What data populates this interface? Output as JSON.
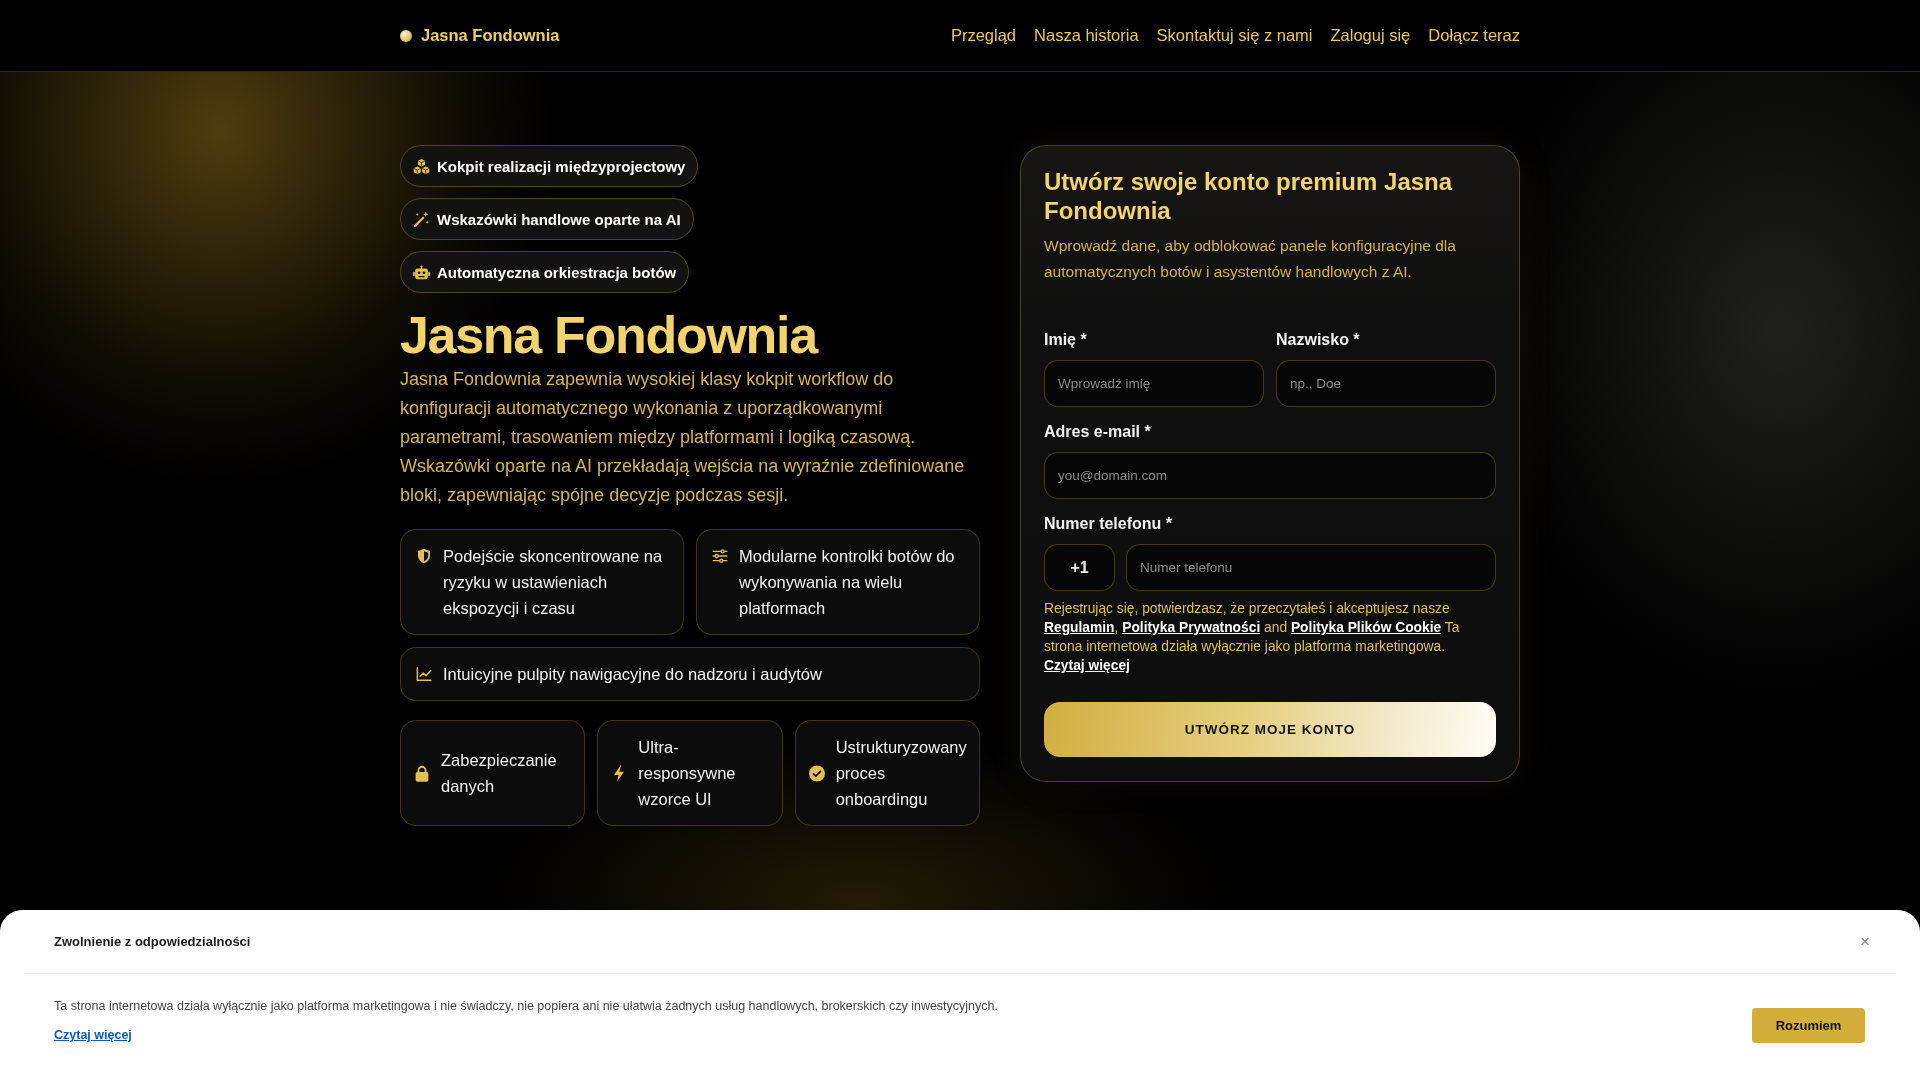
{
  "header": {
    "brand": "Jasna Fondownia",
    "nav": [
      "Przegląd",
      "Nasza historia",
      "Skontaktuj się z nami",
      "Zaloguj się",
      "Dołącz teraz"
    ]
  },
  "hero": {
    "tags": [
      "Kokpit realizacji międzyprojectowy",
      "Wskazówki handlowe oparte na AI",
      "Automatyczna orkiestracja botów"
    ],
    "title": "Jasna Fondownia",
    "description": "Jasna Fondownia zapewnia wysokiej klasy kokpit workflow do konfiguracji automatycznego wykonania z uporządkowanymi parametrami, trasowaniem między platformami i logiką czasową. Wskazówki oparte na AI przekładają wejścia na wyraźnie zdefiniowane bloki, zapewniając spójne decyzje podczas sesji.",
    "feature_rows": [
      [
        "Podejście skoncentrowane na ryzyku w ustawieniach ekspozycji i czasu",
        "Modularne kontrolki botów do wykonywania na wielu platformach"
      ],
      [
        "Intuicyjne pulpity nawigacyjne do nadzoru i audytów"
      ],
      [
        "Zabezpieczanie danych",
        "Ultra-responsywne wzorce UI",
        "Ustrukturyzowany proces onboardingu"
      ]
    ]
  },
  "signup": {
    "title": "Utwórz swoje konto premium Jasna Fondownia",
    "subtitle": "Wprowadź dane, aby odblokować panele konfiguracyjne dla automatycznych botów i asystentów handlowych z AI.",
    "name_fields": [
      {
        "label": "Imię *",
        "placeholder": "Wprowadź imię"
      },
      {
        "label": "Nazwisko *",
        "placeholder": "np., Doe"
      }
    ],
    "email": {
      "label": "Adres e-mail *",
      "placeholder": "you@domain.com"
    },
    "phone": {
      "label": "Numer telefonu *",
      "prefix": "+1",
      "placeholder": "Numer telefonu"
    },
    "consent": [
      {
        "kind": "text",
        "text": "Rejestrując się, potwierdzasz, że przeczytałeś i akceptujesz nasze "
      },
      {
        "kind": "link",
        "text": "Regulamin"
      },
      {
        "kind": "text",
        "text": ", "
      },
      {
        "kind": "link",
        "text": "Polityka Prywatności"
      },
      {
        "kind": "text",
        "text": " and "
      },
      {
        "kind": "link",
        "text": "Polityka Plików Cookie"
      },
      {
        "kind": "text",
        "text": " Ta strona internetowa działa wyłącznie jako platforma marketingowa. "
      },
      {
        "kind": "link",
        "text": "Czytaj więcej"
      }
    ],
    "submit": "UTWÓRZ MOJE KONTO"
  },
  "disclaimer": {
    "title": "Zwolnienie z odpowiedzialności",
    "close": "×",
    "text": "Ta strona internetowa działa wyłącznie jako platforma marketingowa i nie świadczy, nie popiera ani nie ułatwia żadnych usług handlowych, brokerskich czy inwestycyjnych.",
    "link": "Czytaj więcej",
    "button": "Rozumiem"
  }
}
